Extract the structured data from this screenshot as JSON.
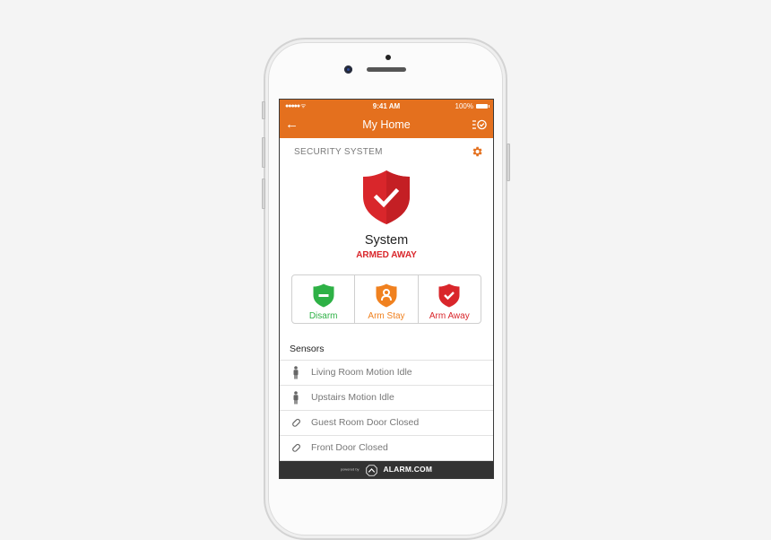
{
  "status_bar": {
    "signal": "●●●●● ᯤ",
    "time": "9:41 AM",
    "battery": "100%"
  },
  "nav": {
    "back_icon": "arrow-left-icon",
    "back_glyph": "←",
    "title": "My Home",
    "menu_icon": "list-check-icon"
  },
  "security": {
    "section_label": "SECURITY SYSTEM",
    "settings_icon": "gear-icon",
    "system_name": "System",
    "system_status": "ARMED AWAY",
    "status_icon": "shield-check-icon"
  },
  "arm_buttons": [
    {
      "label": "Disarm",
      "icon": "shield-minus-icon",
      "color": "#2eb146"
    },
    {
      "label": "Arm Stay",
      "icon": "shield-person-icon",
      "color": "#f0811f"
    },
    {
      "label": "Arm Away",
      "icon": "shield-check-icon",
      "color": "#d9262b"
    }
  ],
  "sensors": {
    "title": "Sensors",
    "items": [
      {
        "label": "Living Room Motion Idle",
        "icon": "person-icon"
      },
      {
        "label": "Upstairs Motion Idle",
        "icon": "person-icon"
      },
      {
        "label": "Guest Room Door Closed",
        "icon": "door-contact-icon"
      },
      {
        "label": "Front Door Closed",
        "icon": "door-contact-icon"
      }
    ]
  },
  "footer": {
    "powered_by": "powered by",
    "brand": "ALARM.COM"
  },
  "colors": {
    "accent": "#e4701e",
    "armed": "#d9262b",
    "disarm": "#2eb146",
    "arm_stay": "#f0811f"
  }
}
